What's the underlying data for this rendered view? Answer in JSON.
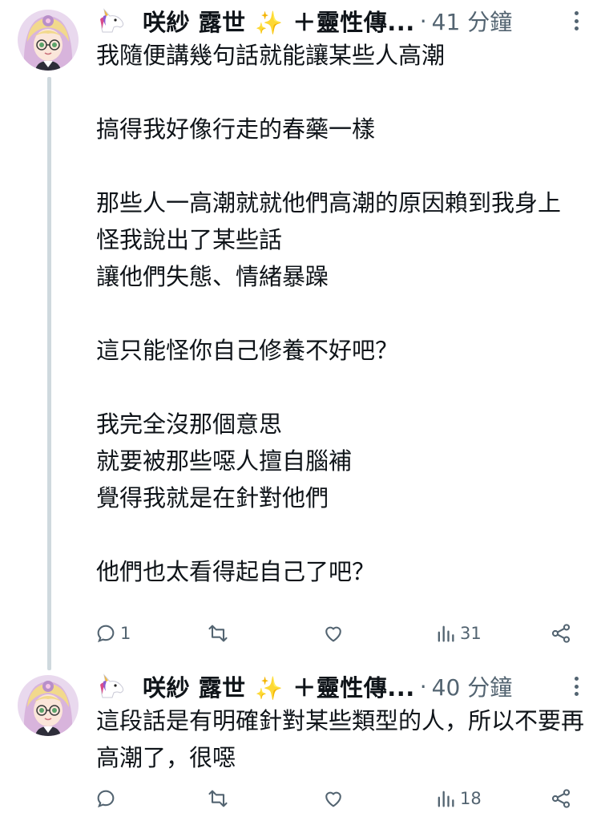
{
  "tweets": [
    {
      "author": {
        "name_part1": "咲紗 露世",
        "sparkle": "✨",
        "name_part2": "＋靈性傳...",
        "avatar_icon": "anime-girl-avatar",
        "badge_icon": "unicorn-icon"
      },
      "separator": "·",
      "time": "41 分鐘",
      "text": "我隨便講幾句話就能讓某些人高潮\n\n搞得我好像行走的春藥一樣\n\n那些人一高潮就就他們高潮的原因賴到我身上\n怪我說出了某些話\n讓他們失態、情緒暴躁\n\n這只能怪你自己修養不好吧？\n\n我完全沒那個意思\n就要被那些噁人擅自腦補\n覺得我就是在針對他們\n\n他們也太看得起自己了吧？",
      "actions": {
        "replies": "1",
        "retweets": "",
        "likes": "",
        "views": "31"
      }
    },
    {
      "author": {
        "name_part1": "咲紗 露世",
        "sparkle": "✨",
        "name_part2": "＋靈性傳...",
        "avatar_icon": "anime-girl-avatar",
        "badge_icon": "unicorn-icon"
      },
      "separator": "·",
      "time": "40 分鐘",
      "text": "這段話是有明確針對某些類型的人，所以不要再高潮了，很噁",
      "actions": {
        "replies": "",
        "retweets": "",
        "likes": "",
        "views": "18"
      }
    }
  ],
  "colors": {
    "text": "#0f1419",
    "muted": "#536471",
    "thread_line": "#cfd9de",
    "sparkle": "#f7c600"
  }
}
